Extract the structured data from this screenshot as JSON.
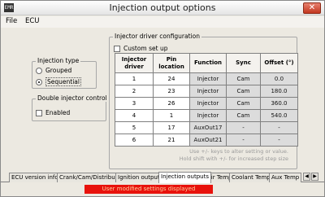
{
  "window": {
    "icon_text": "EMR",
    "title": "Injection output options",
    "close_label": "✕"
  },
  "menu": {
    "file": "File",
    "ecu": "ECU"
  },
  "injection_type": {
    "title": "Injection type",
    "options": [
      {
        "label": "Grouped",
        "selected": false
      },
      {
        "label": "Sequential",
        "selected": true
      }
    ]
  },
  "double_injector": {
    "title": "Double injector control",
    "enabled_label": "Enabled",
    "enabled": false
  },
  "injector_config": {
    "title": "Injector driver configuration",
    "custom_setup_label": "Custom set up",
    "custom_setup": false,
    "columns": [
      "Injector driver",
      "Pin location",
      "Function",
      "Sync",
      "Offset (°)"
    ],
    "rows": [
      {
        "driver": "1",
        "pin": "24",
        "function": "Injector",
        "sync": "Cam",
        "offset": "0.0"
      },
      {
        "driver": "2",
        "pin": "23",
        "function": "Injector",
        "sync": "Cam",
        "offset": "180.0"
      },
      {
        "driver": "3",
        "pin": "26",
        "function": "Injector",
        "sync": "Cam",
        "offset": "360.0"
      },
      {
        "driver": "4",
        "pin": "1",
        "function": "Injector",
        "sync": "Cam",
        "offset": "540.0"
      },
      {
        "driver": "5",
        "pin": "17",
        "function": "AuxOut17",
        "sync": "-",
        "offset": "-"
      },
      {
        "driver": "6",
        "pin": "21",
        "function": "AuxOut21",
        "sync": "-",
        "offset": "-"
      }
    ],
    "hint_line1": "Use +/- keys to alter setting or value.",
    "hint_line2": "Hold shift with +/- for increased step size"
  },
  "tabs": [
    {
      "label": "ECU version info",
      "active": false
    },
    {
      "label": "Crank/Cam/Distributor",
      "active": false
    },
    {
      "label": "Ignition outputs",
      "active": false
    },
    {
      "label": "Injection outputs",
      "active": true
    },
    {
      "label": "Air Temp",
      "active": false
    },
    {
      "label": "Coolant Temp",
      "active": false
    },
    {
      "label": "Aux Temp",
      "active": false
    }
  ],
  "tab_scroll": {
    "left": "◀",
    "right": "▶"
  },
  "status": {
    "text": "User modified settings displayed",
    "color": "#e8120c"
  }
}
